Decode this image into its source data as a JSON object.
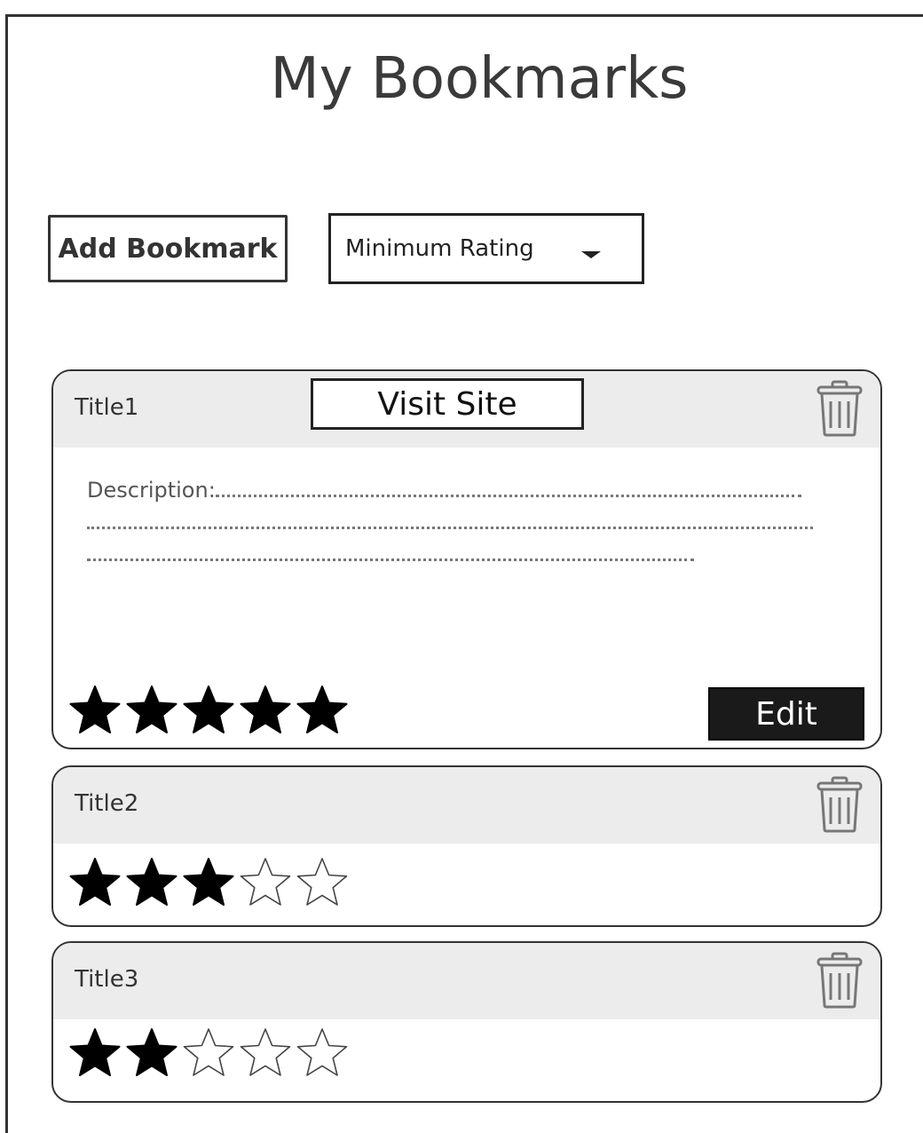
{
  "page": {
    "title": "My Bookmarks"
  },
  "toolbar": {
    "add_label": "Add Bookmark",
    "rating_filter": {
      "selected": "Minimum Rating",
      "icon": "chevron-down-icon"
    }
  },
  "bookmarks": [
    {
      "title": "Title1",
      "visit_label": "Visit Site",
      "description": "Description:",
      "rating": 5,
      "max_rating": 5,
      "edit_label": "Edit",
      "expanded": true
    },
    {
      "title": "Title2",
      "rating": 3,
      "max_rating": 5,
      "expanded": false
    },
    {
      "title": "Title3",
      "rating": 2,
      "max_rating": 5,
      "expanded": false
    }
  ],
  "colors": {
    "header_bg": "#ececec",
    "edit_bg": "#1a1a1a",
    "border": "#333333"
  }
}
